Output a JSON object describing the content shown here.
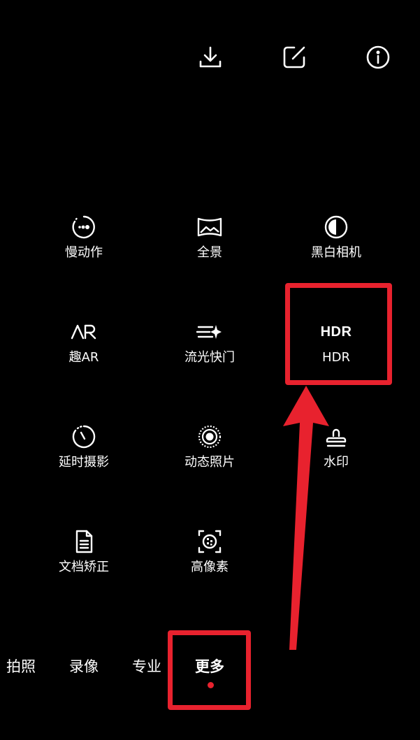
{
  "top_bar": {
    "icons": [
      "download-icon",
      "edit-icon",
      "info-icon"
    ]
  },
  "modes": {
    "slow_motion": {
      "label": "慢动作",
      "icon": "slow-motion-icon"
    },
    "panorama": {
      "label": "全景",
      "icon": "panorama-icon"
    },
    "monochrome": {
      "label": "黑白相机",
      "icon": "monochrome-icon"
    },
    "fun_ar": {
      "label": "趣AR",
      "icon": "ar-icon"
    },
    "light_painting": {
      "label": "流光快门",
      "icon": "light-painting-icon"
    },
    "hdr": {
      "label": "HDR",
      "icon_text": "HDR"
    },
    "time_lapse": {
      "label": "延时摄影",
      "icon": "time-lapse-icon"
    },
    "moving_picture": {
      "label": "动态照片",
      "icon": "moving-picture-icon"
    },
    "watermark": {
      "label": "水印",
      "icon": "watermark-stamp-icon"
    },
    "document": {
      "label": "文档矫正",
      "icon": "document-icon"
    },
    "high_res": {
      "label": "高像素",
      "icon": "high-res-icon"
    }
  },
  "bottom_tabs": {
    "photo": "拍照",
    "video": "录像",
    "pro": "专业",
    "more": "更多",
    "active": "more"
  },
  "colors": {
    "background": "#000000",
    "foreground": "#ffffff",
    "annotation_red": "#e8222e",
    "active_dot": "#e8222e"
  }
}
